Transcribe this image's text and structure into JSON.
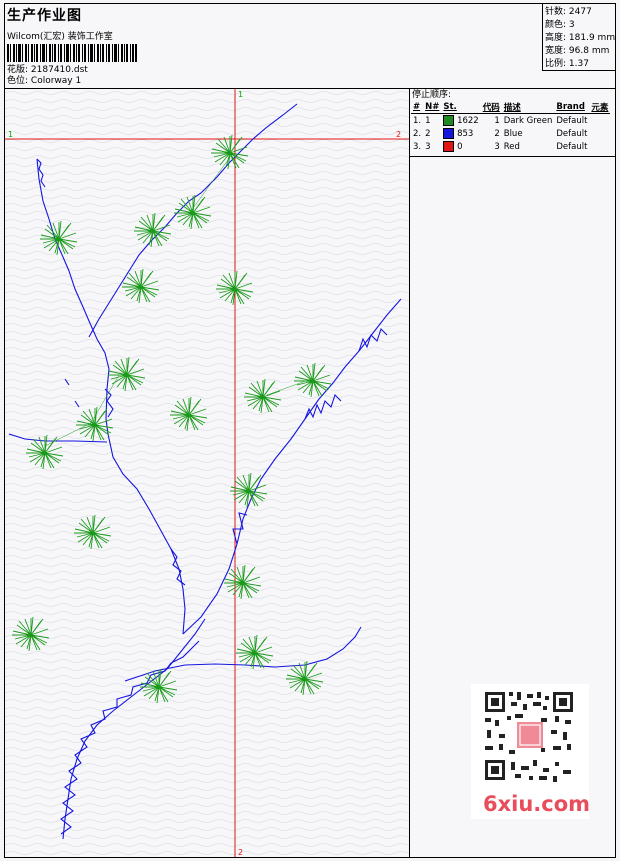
{
  "header": {
    "title": "生产作业图",
    "company": "Wilcom(汇宏) 装饰工作室",
    "design_label": "花版:",
    "design_file": "2187410.dst",
    "color_label": "色位:",
    "colorway": "Colorway 1"
  },
  "stats": {
    "stitches_label": "针数:",
    "stitches": "2477",
    "colors_label": "颜色:",
    "colors": "3",
    "height_label": "高度:",
    "height": "181.9 mm",
    "width_label": "宽度:",
    "width": "96.8 mm",
    "scale_label": "比例:",
    "scale": "1.37"
  },
  "stop_sequence": {
    "title": "停止顺序:",
    "columns": [
      "#",
      "N#",
      "St.",
      "代码",
      "描述",
      "Brand",
      "元素"
    ],
    "rows": [
      {
        "idx": "1.",
        "n": "1",
        "color": "#1f8a1f",
        "st": "1622",
        "code": "1",
        "desc": "Dark Green",
        "brand": "Default",
        "elem": ""
      },
      {
        "idx": "2.",
        "n": "2",
        "color": "#1515e0",
        "st": "853",
        "code": "2",
        "desc": "Blue",
        "brand": "Default",
        "elem": ""
      },
      {
        "idx": "3.",
        "n": "3",
        "color": "#e01515",
        "st": "0",
        "code": "3",
        "desc": "Red",
        "brand": "Default",
        "elem": ""
      }
    ]
  },
  "crosshair": {
    "top_label": "1",
    "bottom_label": "2",
    "left_label": "1",
    "right_label": "2",
    "color": "#e01515",
    "label_top_color": "#00aa00",
    "label_bottom_color": "#e01515"
  },
  "watermark": {
    "text": "6xiu.com"
  }
}
